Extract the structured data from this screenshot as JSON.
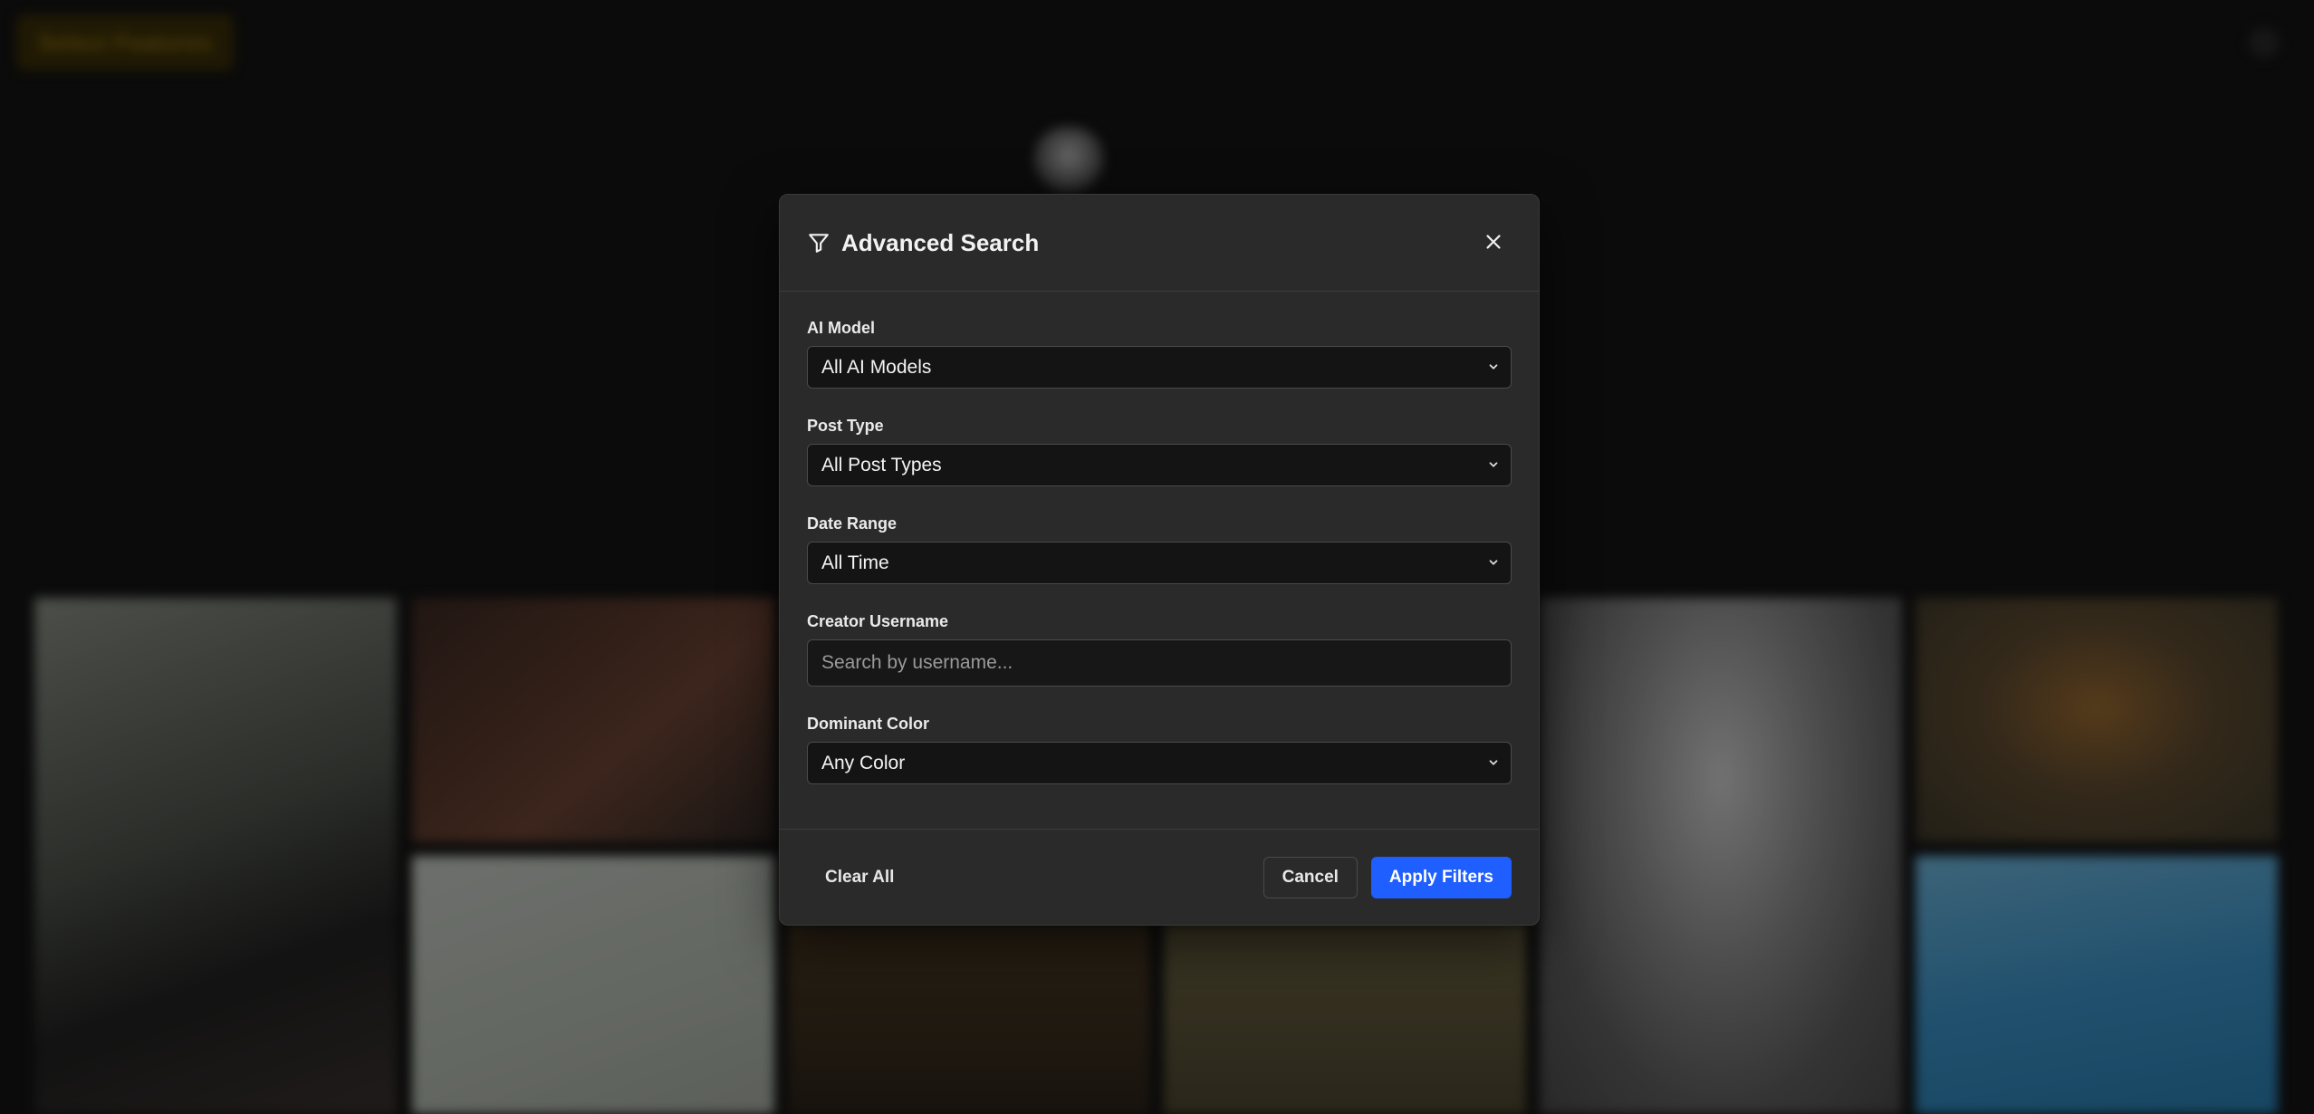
{
  "background": {
    "top_button_label": "Select Features"
  },
  "modal": {
    "title": "Advanced Search",
    "fields": {
      "ai_model": {
        "label": "AI Model",
        "value": "All AI Models"
      },
      "post_type": {
        "label": "Post Type",
        "value": "All Post Types"
      },
      "date_range": {
        "label": "Date Range",
        "value": "All Time"
      },
      "creator_username": {
        "label": "Creator Username",
        "placeholder": "Search by username..."
      },
      "dominant_color": {
        "label": "Dominant Color",
        "value": "Any Color"
      }
    },
    "footer": {
      "clear_label": "Clear All",
      "cancel_label": "Cancel",
      "apply_label": "Apply Filters"
    }
  },
  "colors": {
    "accent": "#1f5eff",
    "modal_bg": "#2a2a2a",
    "input_bg": "#141414"
  },
  "icons": {
    "title_icon": "filter-icon",
    "close_icon": "close-icon",
    "select_icon": "chevron-down-icon"
  }
}
